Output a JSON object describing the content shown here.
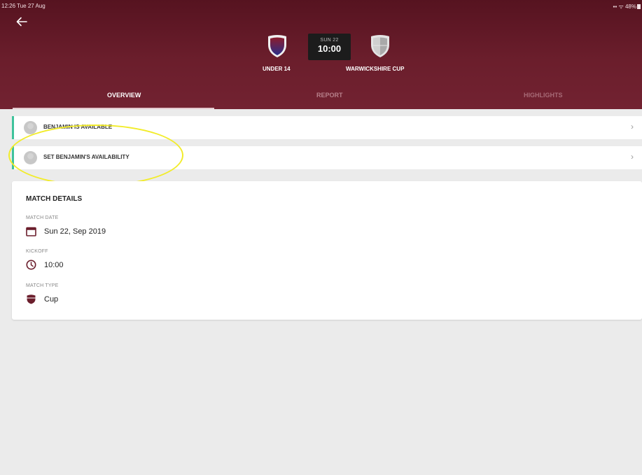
{
  "status_bar": {
    "time": "12:26",
    "date": "Tue 27 Aug",
    "signal": "▪▪",
    "wifi": "ᯤ",
    "battery": "48%"
  },
  "match_header": {
    "home_team": "UNDER 14",
    "away_team": "WARWICKSHIRE CUP",
    "match_day": "SUN 22",
    "kickoff_time": "10:00"
  },
  "tabs": [
    {
      "label": "OVERVIEW",
      "active": true
    },
    {
      "label": "REPORT",
      "active": false
    },
    {
      "label": "HIGHLIGHTS",
      "active": false
    }
  ],
  "availability": [
    {
      "label": "BENJAMIN IS AVAILABLE",
      "chevron": "›"
    },
    {
      "label": "SET BENJAMIN'S AVAILABILITY",
      "chevron": "›"
    }
  ],
  "match_details": {
    "title": "MATCH DETAILS",
    "date_label": "MATCH DATE",
    "date_value": "Sun 22, Sep 2019",
    "kickoff_label": "KICKOFF",
    "kickoff_value": "10:00",
    "type_label": "MATCH TYPE",
    "type_value": "Cup"
  },
  "colors": {
    "header": "#6b1e2c",
    "accent": "#3ec39c",
    "icon": "#6b1e2c",
    "highlight_ring": "#f2ec2a"
  },
  "icons": {
    "back": "back-arrow-icon",
    "date": "calendar-icon",
    "kickoff": "clock-icon",
    "type": "shield-icon",
    "row": "chevron-right-icon"
  }
}
